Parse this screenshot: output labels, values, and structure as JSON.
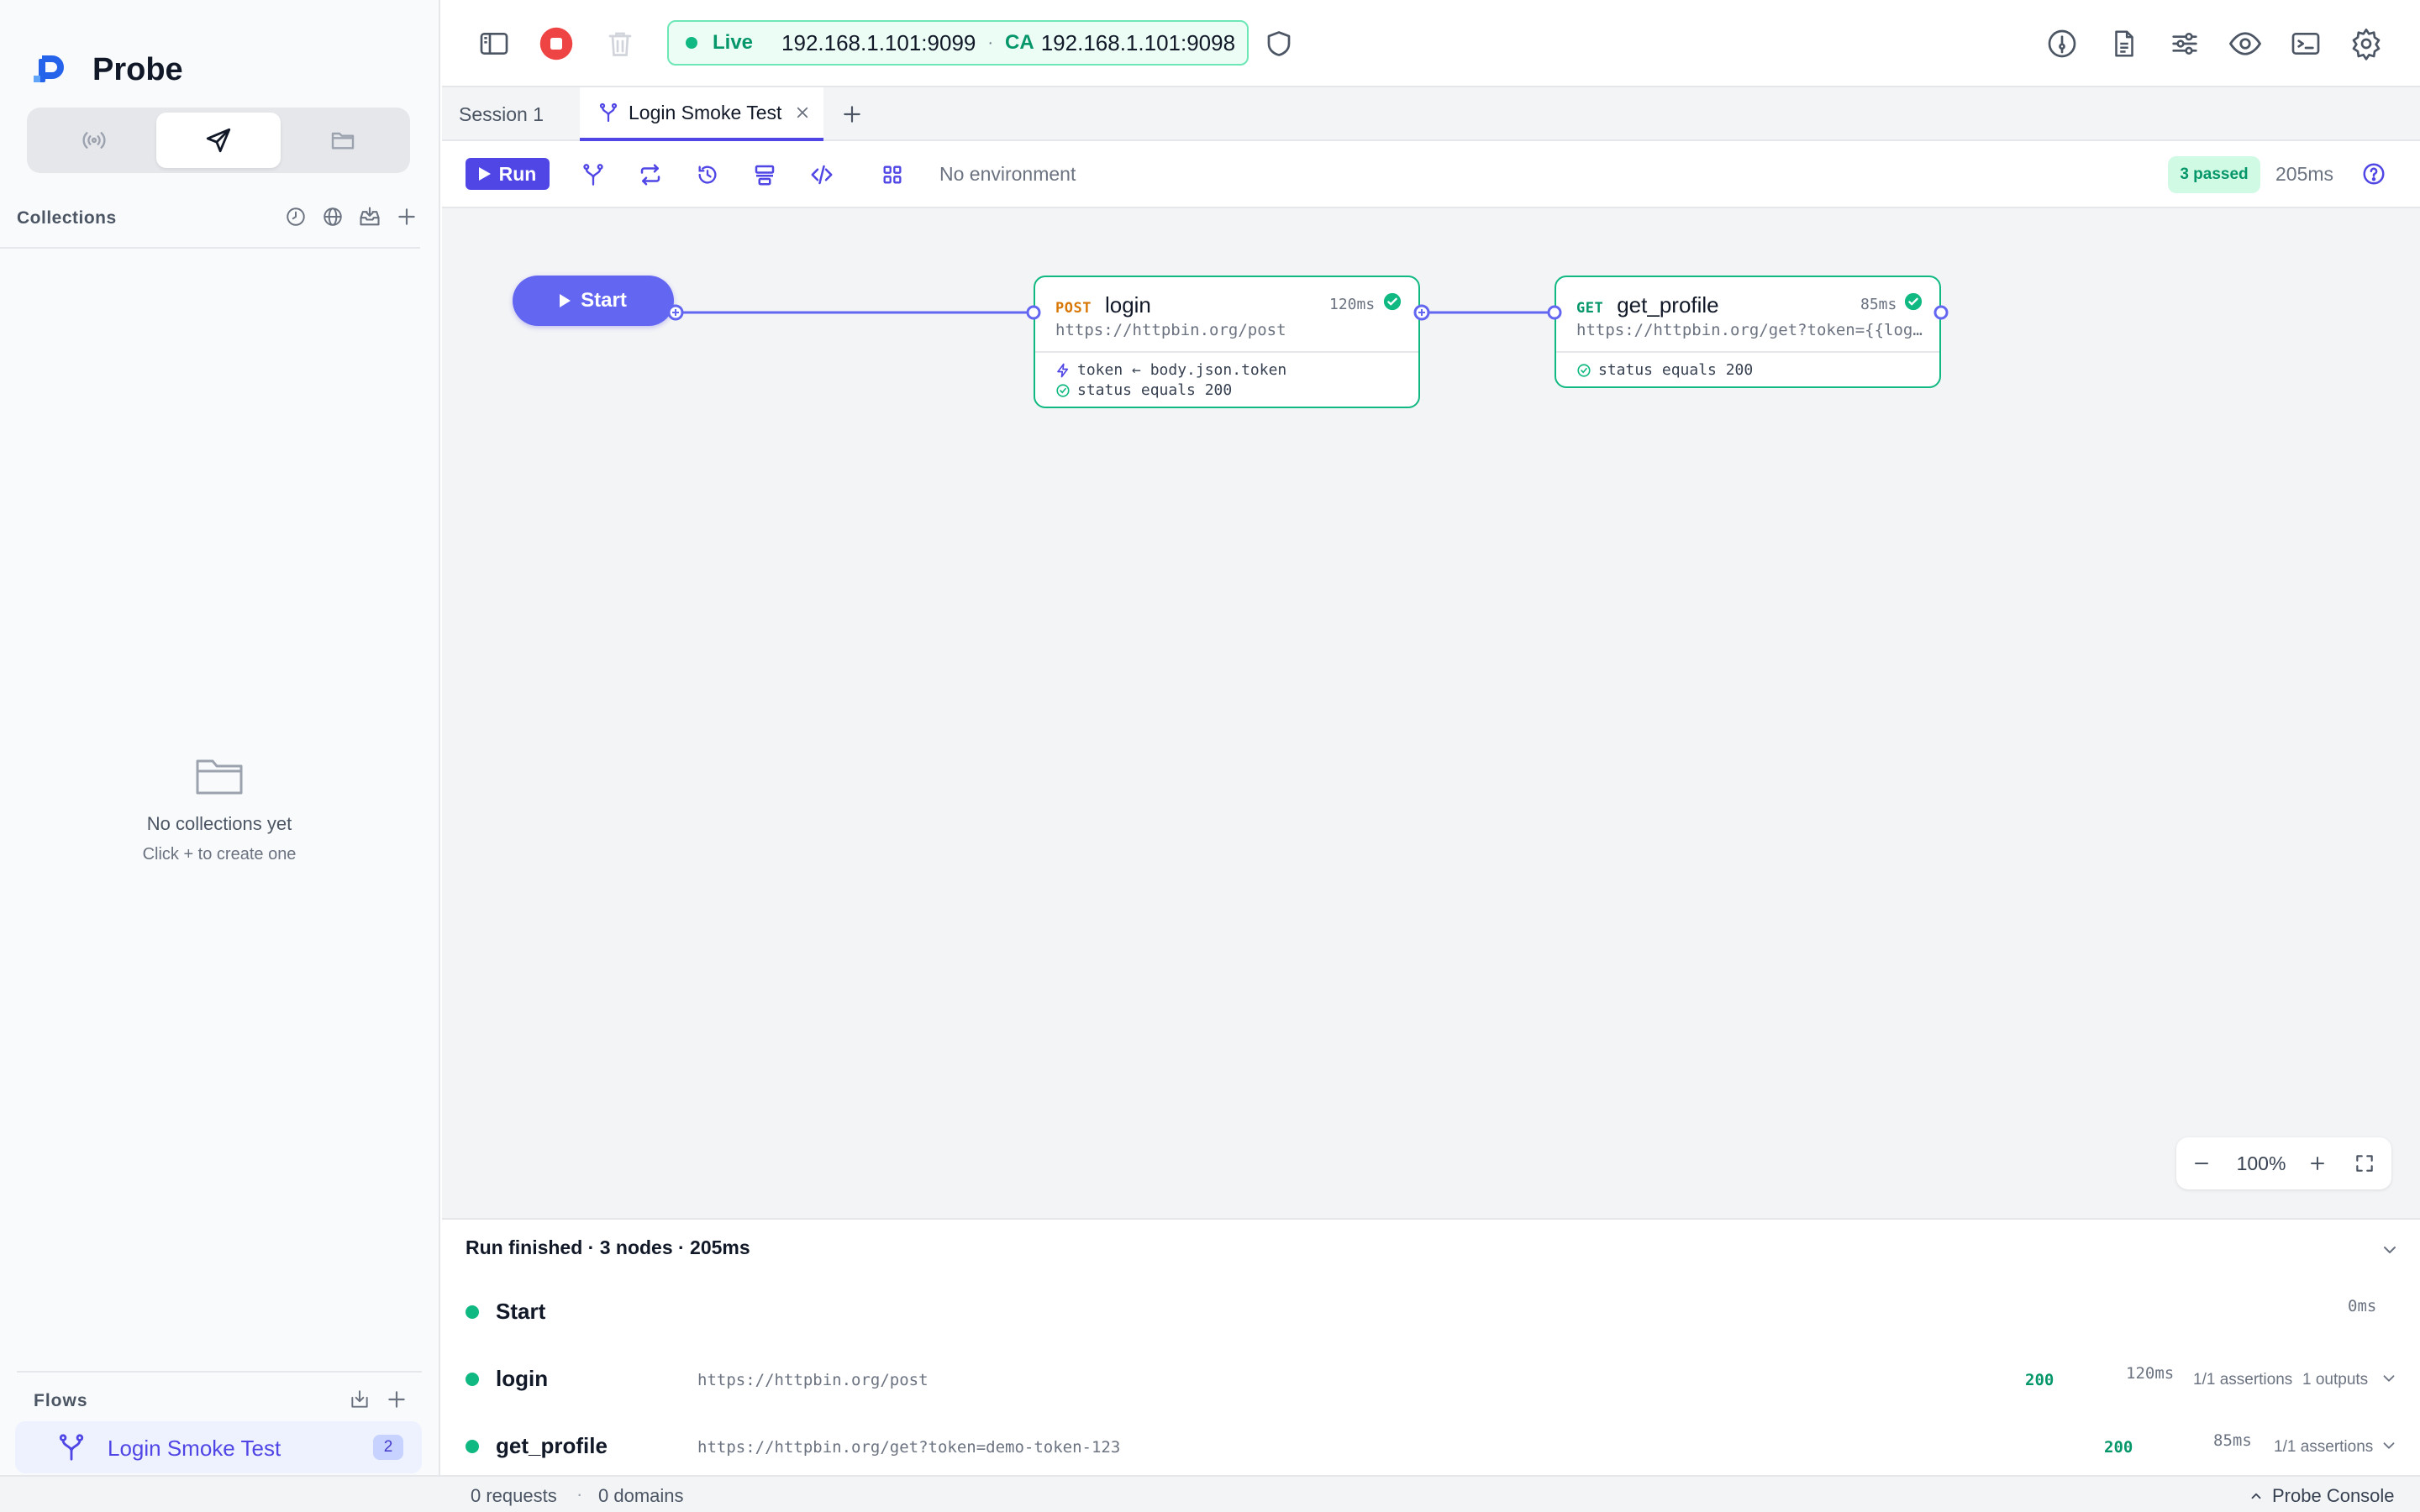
{
  "app": {
    "name": "Probe",
    "colors": {
      "accent": "#4f46e5",
      "success": "#10b981",
      "danger": "#ef4444",
      "method_post": "#d97706",
      "method_get": "#059669"
    }
  },
  "sidebar": {
    "modes": [
      {
        "icon": "broadcast-icon"
      },
      {
        "icon": "send-icon",
        "active": true
      },
      {
        "icon": "folder-icon"
      }
    ],
    "collections": {
      "title": "Collections",
      "icons": [
        "history-icon",
        "globe-icon",
        "import-icon",
        "plus-icon"
      ],
      "empty_title": "No collections yet",
      "empty_hint": "Click + to create one"
    },
    "flows": {
      "title": "Flows",
      "icons": [
        "import-icon",
        "plus-icon"
      ],
      "items": [
        {
          "label": "Login Smoke Test",
          "count": "2",
          "icon": "flow-icon"
        }
      ]
    }
  },
  "topbar": {
    "icons_left": [
      "sidebar-toggle-icon",
      "stop-icon",
      "trash-icon"
    ],
    "live": {
      "label": "Live",
      "address": "192.168.1.101:9099",
      "separator": "·",
      "ca_label": "CA",
      "ca_address": "192.168.1.101:9098"
    },
    "icons_right": [
      "gauge-icon",
      "document-icon",
      "sliders-icon",
      "eye-icon",
      "terminal-icon",
      "gear-icon"
    ]
  },
  "tabs": [
    {
      "label": "Session 1",
      "active": false
    },
    {
      "label": "Login Smoke Test",
      "active": true,
      "icon": "flow-icon"
    }
  ],
  "flowbar": {
    "run_label": "Run",
    "environment": "No environment",
    "passed": "3 passed",
    "duration": "205ms"
  },
  "canvas": {
    "start_label": "Start",
    "zoom": "100%",
    "nodes": [
      {
        "method": "POST",
        "name": "login",
        "time": "120ms",
        "url": "https://httpbin.org/post",
        "extract": "token ← body.json.token",
        "assert": "status equals 200"
      },
      {
        "method": "GET",
        "name": "get_profile",
        "time": "85ms",
        "url": "https://httpbin.org/get?token={{login.token}}",
        "assert": "status equals 200"
      }
    ]
  },
  "run_panel": {
    "title": "Run finished · 3 nodes · 205ms",
    "rows": [
      {
        "name": "Start",
        "url": "",
        "status": "",
        "time": "0ms",
        "assertions": "",
        "outputs": ""
      },
      {
        "name": "login",
        "url": "https://httpbin.org/post",
        "status": "200",
        "time": "120ms",
        "assertions": "1/1 assertions",
        "outputs": "1 outputs"
      },
      {
        "name": "get_profile",
        "url": "https://httpbin.org/get?token=demo-token-123",
        "status": "200",
        "time": "85ms",
        "assertions": "1/1 assertions",
        "outputs": ""
      }
    ]
  },
  "statusbar": {
    "requests": "0 requests",
    "separator": "·",
    "domains": "0 domains",
    "console": "Probe Console"
  }
}
